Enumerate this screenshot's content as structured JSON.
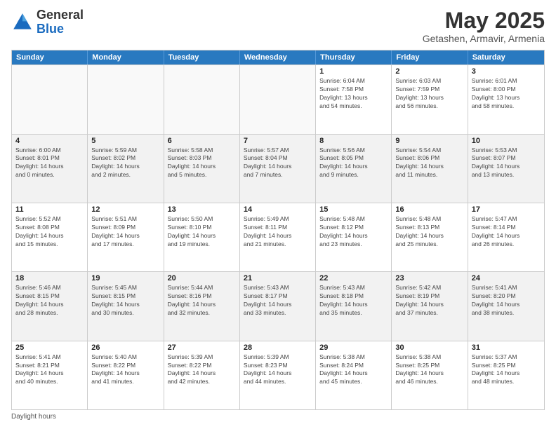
{
  "header": {
    "logo_line1": "General",
    "logo_line2": "Blue",
    "month_title": "May 2025",
    "subtitle": "Getashen, Armavir, Armenia"
  },
  "days_of_week": [
    "Sunday",
    "Monday",
    "Tuesday",
    "Wednesday",
    "Thursday",
    "Friday",
    "Saturday"
  ],
  "footer": {
    "daylight_label": "Daylight hours"
  },
  "weeks": [
    [
      {
        "day": "",
        "info": ""
      },
      {
        "day": "",
        "info": ""
      },
      {
        "day": "",
        "info": ""
      },
      {
        "day": "",
        "info": ""
      },
      {
        "day": "1",
        "info": "Sunrise: 6:04 AM\nSunset: 7:58 PM\nDaylight: 13 hours\nand 54 minutes."
      },
      {
        "day": "2",
        "info": "Sunrise: 6:03 AM\nSunset: 7:59 PM\nDaylight: 13 hours\nand 56 minutes."
      },
      {
        "day": "3",
        "info": "Sunrise: 6:01 AM\nSunset: 8:00 PM\nDaylight: 13 hours\nand 58 minutes."
      }
    ],
    [
      {
        "day": "4",
        "info": "Sunrise: 6:00 AM\nSunset: 8:01 PM\nDaylight: 14 hours\nand 0 minutes."
      },
      {
        "day": "5",
        "info": "Sunrise: 5:59 AM\nSunset: 8:02 PM\nDaylight: 14 hours\nand 2 minutes."
      },
      {
        "day": "6",
        "info": "Sunrise: 5:58 AM\nSunset: 8:03 PM\nDaylight: 14 hours\nand 5 minutes."
      },
      {
        "day": "7",
        "info": "Sunrise: 5:57 AM\nSunset: 8:04 PM\nDaylight: 14 hours\nand 7 minutes."
      },
      {
        "day": "8",
        "info": "Sunrise: 5:56 AM\nSunset: 8:05 PM\nDaylight: 14 hours\nand 9 minutes."
      },
      {
        "day": "9",
        "info": "Sunrise: 5:54 AM\nSunset: 8:06 PM\nDaylight: 14 hours\nand 11 minutes."
      },
      {
        "day": "10",
        "info": "Sunrise: 5:53 AM\nSunset: 8:07 PM\nDaylight: 14 hours\nand 13 minutes."
      }
    ],
    [
      {
        "day": "11",
        "info": "Sunrise: 5:52 AM\nSunset: 8:08 PM\nDaylight: 14 hours\nand 15 minutes."
      },
      {
        "day": "12",
        "info": "Sunrise: 5:51 AM\nSunset: 8:09 PM\nDaylight: 14 hours\nand 17 minutes."
      },
      {
        "day": "13",
        "info": "Sunrise: 5:50 AM\nSunset: 8:10 PM\nDaylight: 14 hours\nand 19 minutes."
      },
      {
        "day": "14",
        "info": "Sunrise: 5:49 AM\nSunset: 8:11 PM\nDaylight: 14 hours\nand 21 minutes."
      },
      {
        "day": "15",
        "info": "Sunrise: 5:48 AM\nSunset: 8:12 PM\nDaylight: 14 hours\nand 23 minutes."
      },
      {
        "day": "16",
        "info": "Sunrise: 5:48 AM\nSunset: 8:13 PM\nDaylight: 14 hours\nand 25 minutes."
      },
      {
        "day": "17",
        "info": "Sunrise: 5:47 AM\nSunset: 8:14 PM\nDaylight: 14 hours\nand 26 minutes."
      }
    ],
    [
      {
        "day": "18",
        "info": "Sunrise: 5:46 AM\nSunset: 8:15 PM\nDaylight: 14 hours\nand 28 minutes."
      },
      {
        "day": "19",
        "info": "Sunrise: 5:45 AM\nSunset: 8:15 PM\nDaylight: 14 hours\nand 30 minutes."
      },
      {
        "day": "20",
        "info": "Sunrise: 5:44 AM\nSunset: 8:16 PM\nDaylight: 14 hours\nand 32 minutes."
      },
      {
        "day": "21",
        "info": "Sunrise: 5:43 AM\nSunset: 8:17 PM\nDaylight: 14 hours\nand 33 minutes."
      },
      {
        "day": "22",
        "info": "Sunrise: 5:43 AM\nSunset: 8:18 PM\nDaylight: 14 hours\nand 35 minutes."
      },
      {
        "day": "23",
        "info": "Sunrise: 5:42 AM\nSunset: 8:19 PM\nDaylight: 14 hours\nand 37 minutes."
      },
      {
        "day": "24",
        "info": "Sunrise: 5:41 AM\nSunset: 8:20 PM\nDaylight: 14 hours\nand 38 minutes."
      }
    ],
    [
      {
        "day": "25",
        "info": "Sunrise: 5:41 AM\nSunset: 8:21 PM\nDaylight: 14 hours\nand 40 minutes."
      },
      {
        "day": "26",
        "info": "Sunrise: 5:40 AM\nSunset: 8:22 PM\nDaylight: 14 hours\nand 41 minutes."
      },
      {
        "day": "27",
        "info": "Sunrise: 5:39 AM\nSunset: 8:22 PM\nDaylight: 14 hours\nand 42 minutes."
      },
      {
        "day": "28",
        "info": "Sunrise: 5:39 AM\nSunset: 8:23 PM\nDaylight: 14 hours\nand 44 minutes."
      },
      {
        "day": "29",
        "info": "Sunrise: 5:38 AM\nSunset: 8:24 PM\nDaylight: 14 hours\nand 45 minutes."
      },
      {
        "day": "30",
        "info": "Sunrise: 5:38 AM\nSunset: 8:25 PM\nDaylight: 14 hours\nand 46 minutes."
      },
      {
        "day": "31",
        "info": "Sunrise: 5:37 AM\nSunset: 8:25 PM\nDaylight: 14 hours\nand 48 minutes."
      }
    ]
  ]
}
